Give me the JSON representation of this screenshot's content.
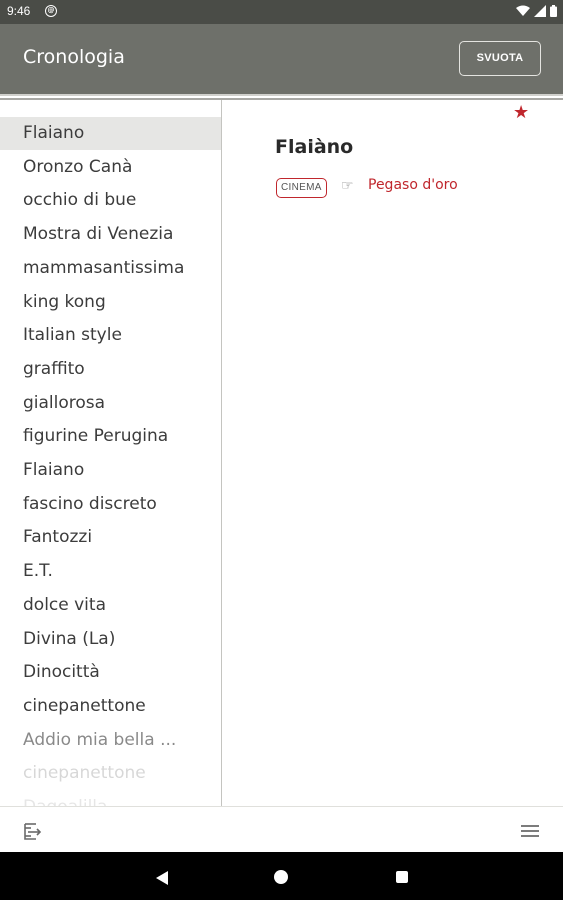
{
  "status_bar": {
    "time": "9:46",
    "notification_icon": "sync-icon"
  },
  "app_bar": {
    "title": "Cronologia",
    "clear_button": "SVUOTA"
  },
  "history": {
    "selected_index": 0,
    "items": [
      "Flaiano",
      "Oronzo Canà",
      "occhio di bue",
      "Mostra di Venezia",
      "mammasantissima",
      "king kong",
      "Italian style",
      "graffito",
      "giallorosa",
      "figurine Perugina",
      "Flaiano",
      "fascino discreto",
      "Fantozzi",
      "E.T.",
      "dolce vita",
      "Divina (La)",
      "Dinocittà",
      "cinepanettone",
      "Addio mia bella ...",
      "cinepanettone",
      "Dagoalilla"
    ]
  },
  "detail": {
    "title": "Flaiàno",
    "favorite_icon": "star-icon",
    "tag": "CINEMA",
    "see_also_icon": "pointing-hand-icon",
    "see_also_hand": "☞",
    "link": "Pegaso d'oro"
  },
  "toolbar": {
    "left_icon": "export-icon",
    "right_icon": "menu-icon"
  },
  "colors": {
    "app_bar": "#6e706a",
    "status_bar": "#4a4c47",
    "accent_red": "#c0272d",
    "selected_row": "#e6e6e4"
  }
}
